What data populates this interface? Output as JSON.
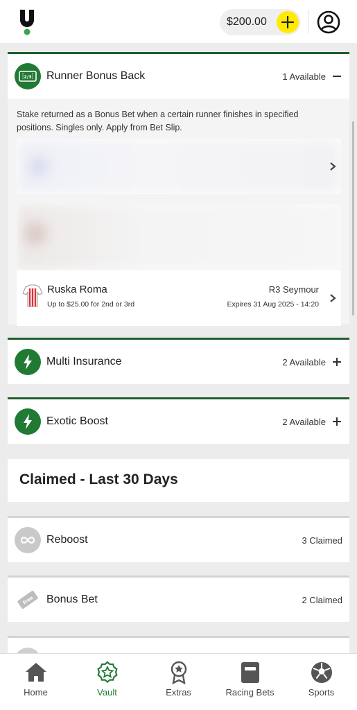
{
  "header": {
    "balance": "$200.00",
    "logo_icon": "unibet-u-logo",
    "add_icon": "plus-icon",
    "account_icon": "user-circle-icon"
  },
  "runner_bonus_back": {
    "title": "Runner Bonus Back",
    "count": "1 Available",
    "description": "Stake returned as a Bonus Bet when a certain runner finishes in specified positions. Singles only. Apply from Bet Slip.",
    "offer": {
      "runner_name": "Ruska Roma",
      "offer_text": "Up to $25.00 for 2nd or 3rd",
      "race": "R3 Seymour",
      "expires": "Expires 31 Aug 2025 - 14:20"
    }
  },
  "multi_insurance": {
    "title": "Multi Insurance",
    "count": "2 Available"
  },
  "exotic_boost": {
    "title": "Exotic Boost",
    "count": "2 Available"
  },
  "claimed": {
    "heading": "Claimed - Last 30 Days",
    "items": [
      {
        "title": "Reboost",
        "count": "3 Claimed"
      },
      {
        "title": "Bonus Bet",
        "count": "2 Claimed"
      }
    ]
  },
  "nav": {
    "items": [
      {
        "label": "Home",
        "icon": "home-icon"
      },
      {
        "label": "Vault",
        "icon": "vault-star-icon"
      },
      {
        "label": "Extras",
        "icon": "extras-medal-icon"
      },
      {
        "label": "Racing Bets",
        "icon": "racing-bets-icon"
      },
      {
        "label": "Sports",
        "icon": "soccer-ball-icon"
      }
    ]
  },
  "colors": {
    "brand_green": "#217a33",
    "header_accent": "#ffeb00",
    "section_border": "#1f5e2e"
  }
}
